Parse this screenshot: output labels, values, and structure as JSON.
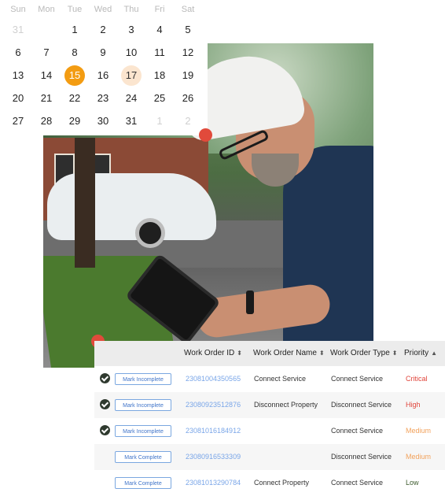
{
  "calendar": {
    "weekdays": [
      "Sun",
      "Mon",
      "Tue",
      "Wed",
      "Thu",
      "Fri",
      "Sat"
    ],
    "weeks": [
      [
        "31",
        "",
        "1",
        "2",
        "3",
        "4",
        "5"
      ],
      [
        "6",
        "7",
        "8",
        "9",
        "10",
        "11",
        "12"
      ],
      [
        "13",
        "14",
        "15",
        "16",
        "17",
        "18",
        "19"
      ],
      [
        "20",
        "21",
        "22",
        "23",
        "24",
        "25",
        "26"
      ],
      [
        "27",
        "28",
        "29",
        "30",
        "31",
        "1",
        "2"
      ]
    ],
    "today": "15",
    "selected": "17"
  },
  "table": {
    "headers": {
      "id": "Work Order ID",
      "name": "Work Order Name",
      "type": "Work Order Type",
      "priority": "Priority"
    },
    "rows": [
      {
        "action": "Mark Incomplete",
        "id": "23081004350565",
        "name": "Connect Service",
        "type": "Connect Service",
        "priority": "Critical",
        "checked": true
      },
      {
        "action": "Mark Incomplete",
        "id": "23080923512876",
        "name": "Disconnect Property",
        "type": "Disconnect Service",
        "priority": "High",
        "checked": true
      },
      {
        "action": "Mark Incomplete",
        "id": "23081016184912",
        "name": "",
        "type": "Connect Service",
        "priority": "Medium",
        "checked": true
      },
      {
        "action": "Mark Complete",
        "id": "23080916533309",
        "name": "",
        "type": "Disconnect Service",
        "priority": "Medium",
        "checked": false
      },
      {
        "action": "Mark Complete",
        "id": "23081013290784",
        "name": "Connect Property",
        "type": "Connect Service",
        "priority": "Low",
        "checked": false
      }
    ]
  },
  "colors": {
    "accent": "#f39c12",
    "marker": "#e14a3b",
    "link": "#7aa6e8"
  }
}
